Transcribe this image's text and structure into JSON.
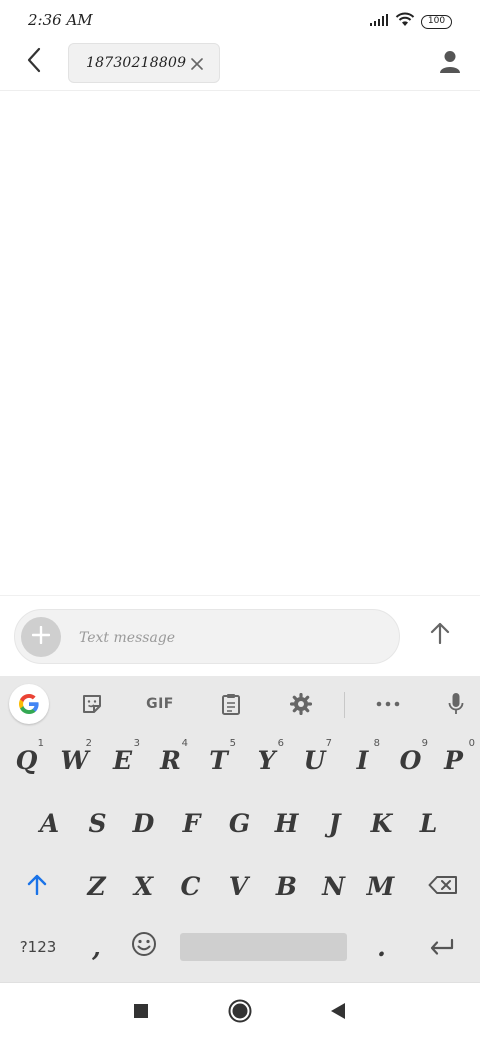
{
  "status_bar": {
    "time": "2:36 AM",
    "battery_level": "100",
    "icons": [
      "signal-icon",
      "wifi-icon",
      "battery-icon"
    ]
  },
  "header": {
    "back_icon": "chevron-left-icon",
    "recipient": "18730218809",
    "chip_close_icon": "close-icon",
    "contact_icon": "person-icon"
  },
  "compose": {
    "attach_icon": "plus-icon",
    "placeholder": "Text message",
    "send_icon": "arrow-up-icon"
  },
  "keyboard": {
    "toolbar": {
      "items": [
        "google-icon",
        "sticker-icon",
        "GIF",
        "clipboard-icon",
        "gear-icon",
        "more-icon",
        "mic-icon"
      ],
      "gif_label": "GIF"
    },
    "row1": [
      {
        "label": "Q",
        "hint": "1"
      },
      {
        "label": "W",
        "hint": "2"
      },
      {
        "label": "E",
        "hint": "3"
      },
      {
        "label": "R",
        "hint": "4"
      },
      {
        "label": "T",
        "hint": "5"
      },
      {
        "label": "Y",
        "hint": "6"
      },
      {
        "label": "U",
        "hint": "7"
      },
      {
        "label": "I",
        "hint": "8"
      },
      {
        "label": "O",
        "hint": "9"
      },
      {
        "label": "P",
        "hint": "0"
      }
    ],
    "row2": [
      "A",
      "S",
      "D",
      "F",
      "G",
      "H",
      "J",
      "K",
      "L"
    ],
    "row3": [
      "Z",
      "X",
      "C",
      "V",
      "B",
      "N",
      "M"
    ],
    "row4": {
      "symbols_label": "?123",
      "comma": ",",
      "period": ".",
      "emoji_icon": "emoji-icon",
      "enter_icon": "enter-icon"
    },
    "shift_icon": "shift-icon",
    "backspace_icon": "backspace-icon"
  },
  "nav_bar": {
    "items": [
      "recents-icon",
      "home-icon",
      "back-icon"
    ]
  },
  "colors": {
    "accent": "#1a73e8",
    "keyboard_bg": "#e9e9e9",
    "chip_bg": "#f1f1f1",
    "compose_bg": "#f2f2f2"
  }
}
